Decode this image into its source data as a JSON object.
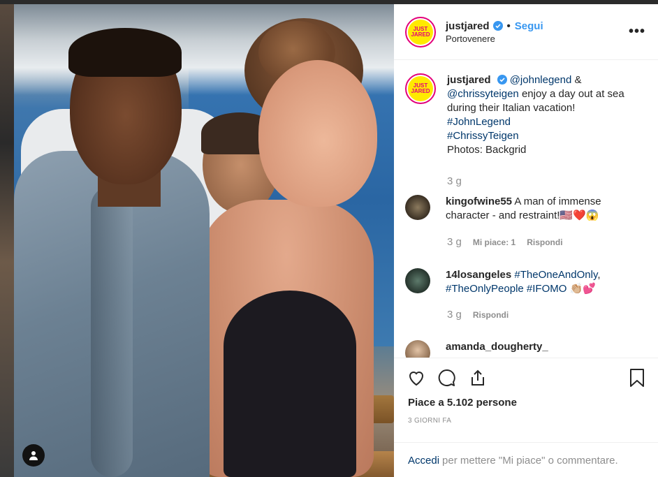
{
  "post": {
    "username": "justjared",
    "follow_label": "Segui",
    "dot": "•",
    "location": "Portovenere",
    "avatar_text_1": "JUST",
    "avatar_text_2": "JARED",
    "more_label": "•••"
  },
  "caption": {
    "username": "justjared",
    "mention1": "@johnlegend",
    "amp": " & ",
    "mention2": "@chrissyteigen",
    "text": " enjoy a day out at sea during their Italian vacation!",
    "tag1": "#JohnLegend",
    "tag2": "#ChrissyTeigen",
    "credit": "Photos: Backgrid",
    "time": "3 g"
  },
  "comments": [
    {
      "username": "kingofwine55",
      "text": "A man of immense character - and restraint!🇺🇸❤️😱",
      "time": "3 g",
      "likes": "Mi piace: 1",
      "reply": "Rispondi"
    },
    {
      "username": "14losangeles",
      "tag1": "#TheOneAndOnly",
      "sep": ",",
      "tag2": "#TheOnlyPeople",
      "tag3": "#IFOMO",
      "emoji": " 👏🏼💕",
      "time": "3 g",
      "reply": "Rispondi"
    },
    {
      "username": "amanda_dougherty_"
    }
  ],
  "actions": {
    "likes_text": "Piace a 5.102 persone",
    "date": "3 GIORNI FA",
    "login_link": "Accedi",
    "login_rest": "per mettere \"Mi piace\" o commentare."
  },
  "colors": {
    "accent": "#3897f0",
    "link": "#00376b",
    "muted": "#8e8e8e",
    "text": "#262626",
    "avatar_bg": "#ffea00",
    "avatar_ring": "#e3007a"
  }
}
